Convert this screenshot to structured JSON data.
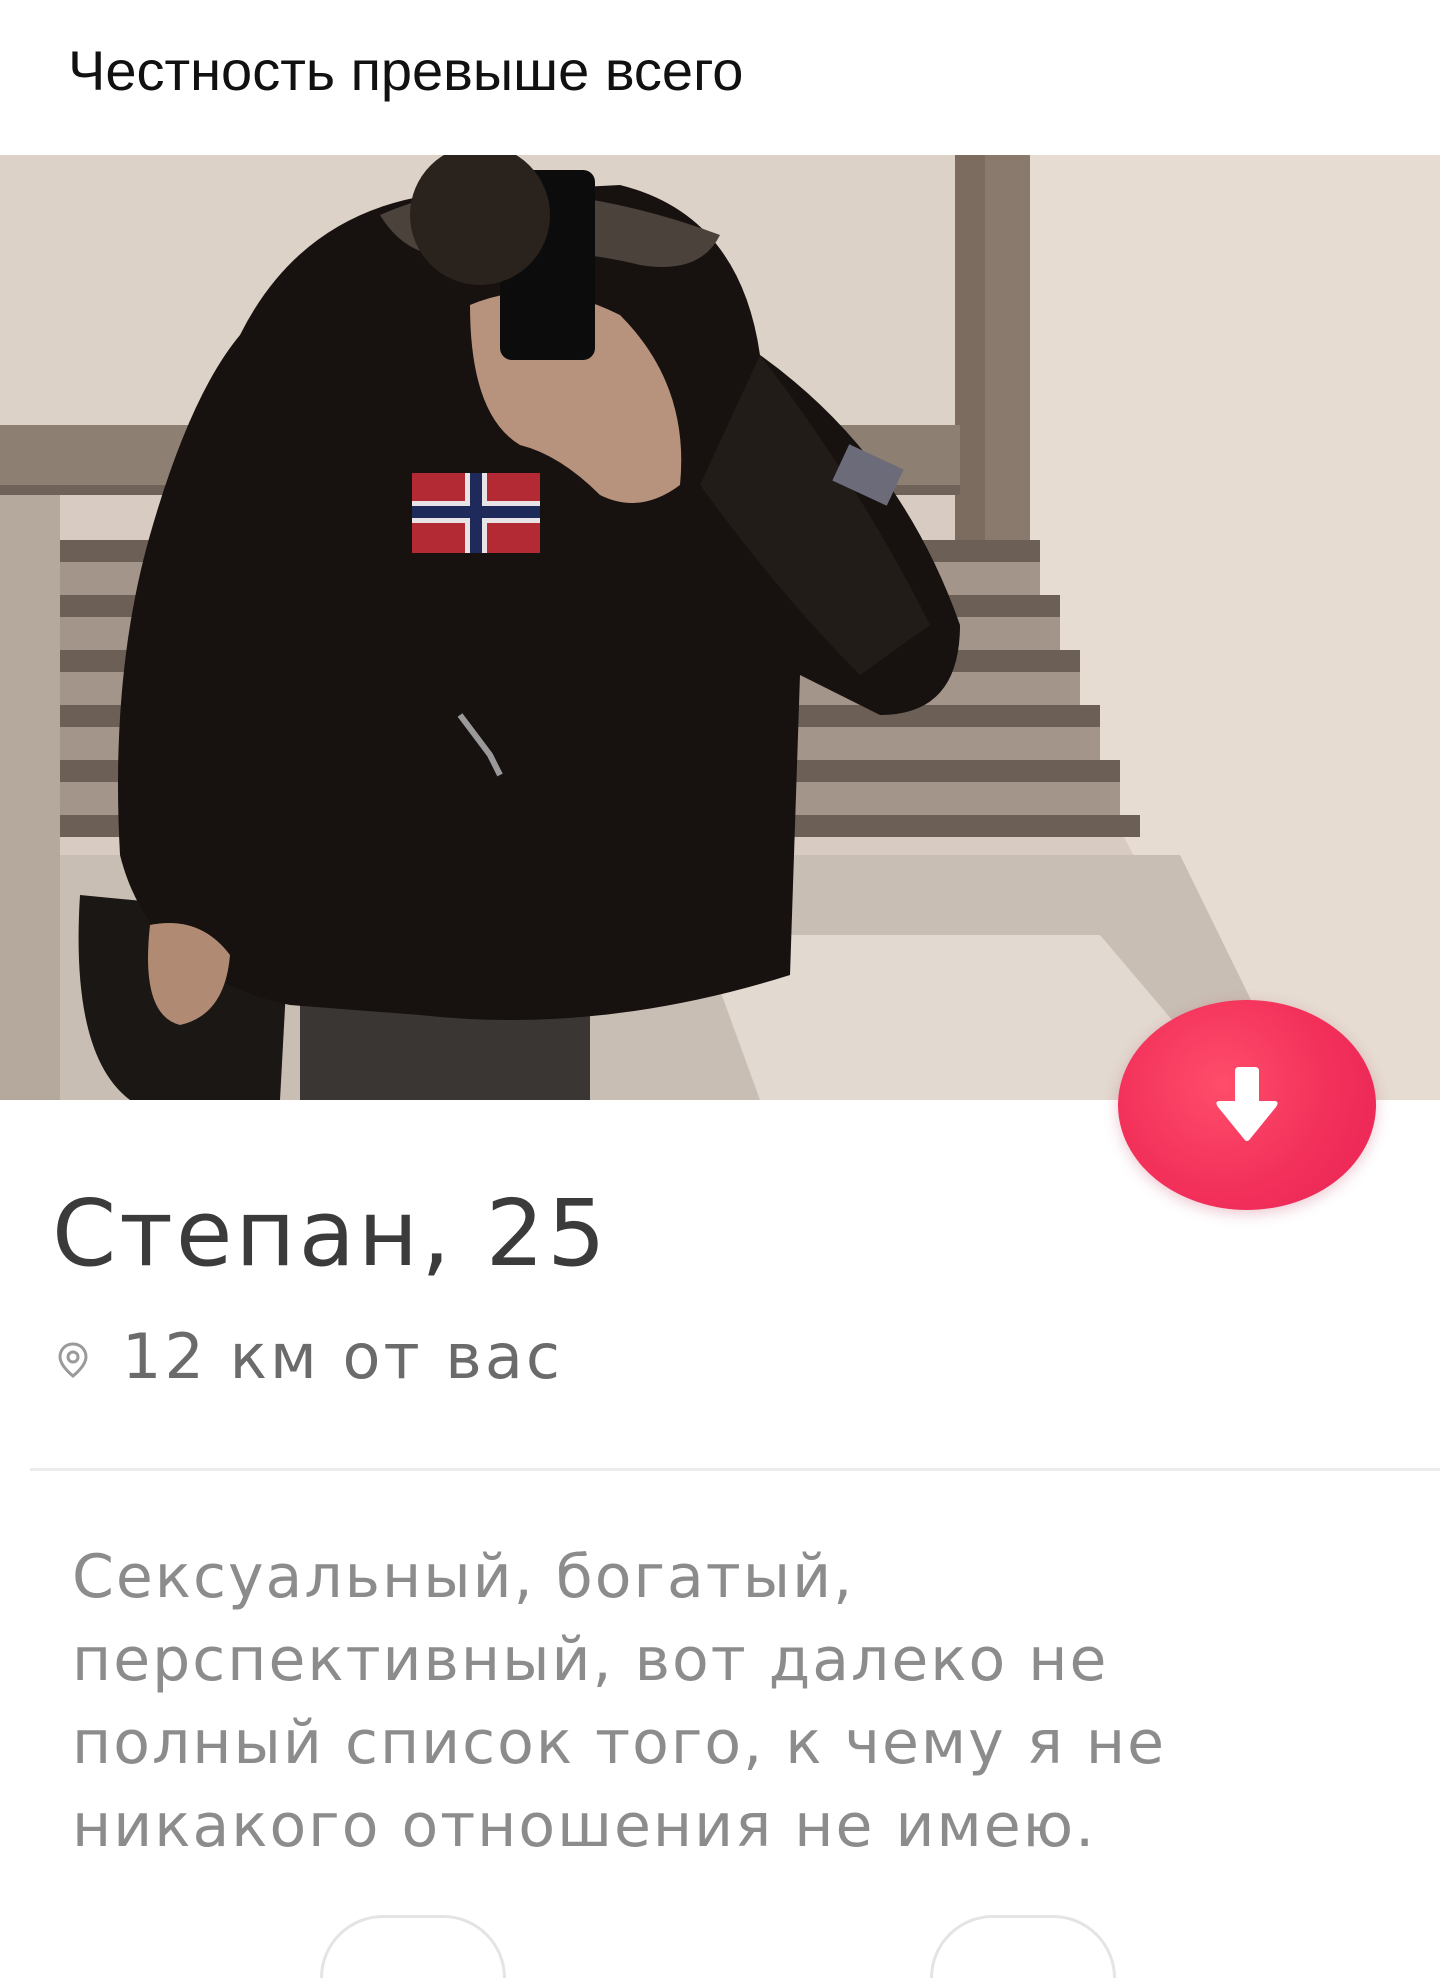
{
  "post": {
    "title": "Честность превыше всего"
  },
  "profile": {
    "name_age": "Степан, 25",
    "distance": "12 км от вас",
    "bio_line_1": "Сексуальный, богатый,",
    "bio_line_2": "перспективный, вот далеко не",
    "bio_line_3": "полный список того, к чему я не",
    "bio_line_4": "никакого отношения не имею."
  },
  "icons": {
    "dislike": "arrow-down-icon",
    "location": "location-pin-icon"
  },
  "colors": {
    "accent": "#f2305a",
    "name": "#3b3b3b",
    "secondary_text": "#8c8c8c"
  }
}
